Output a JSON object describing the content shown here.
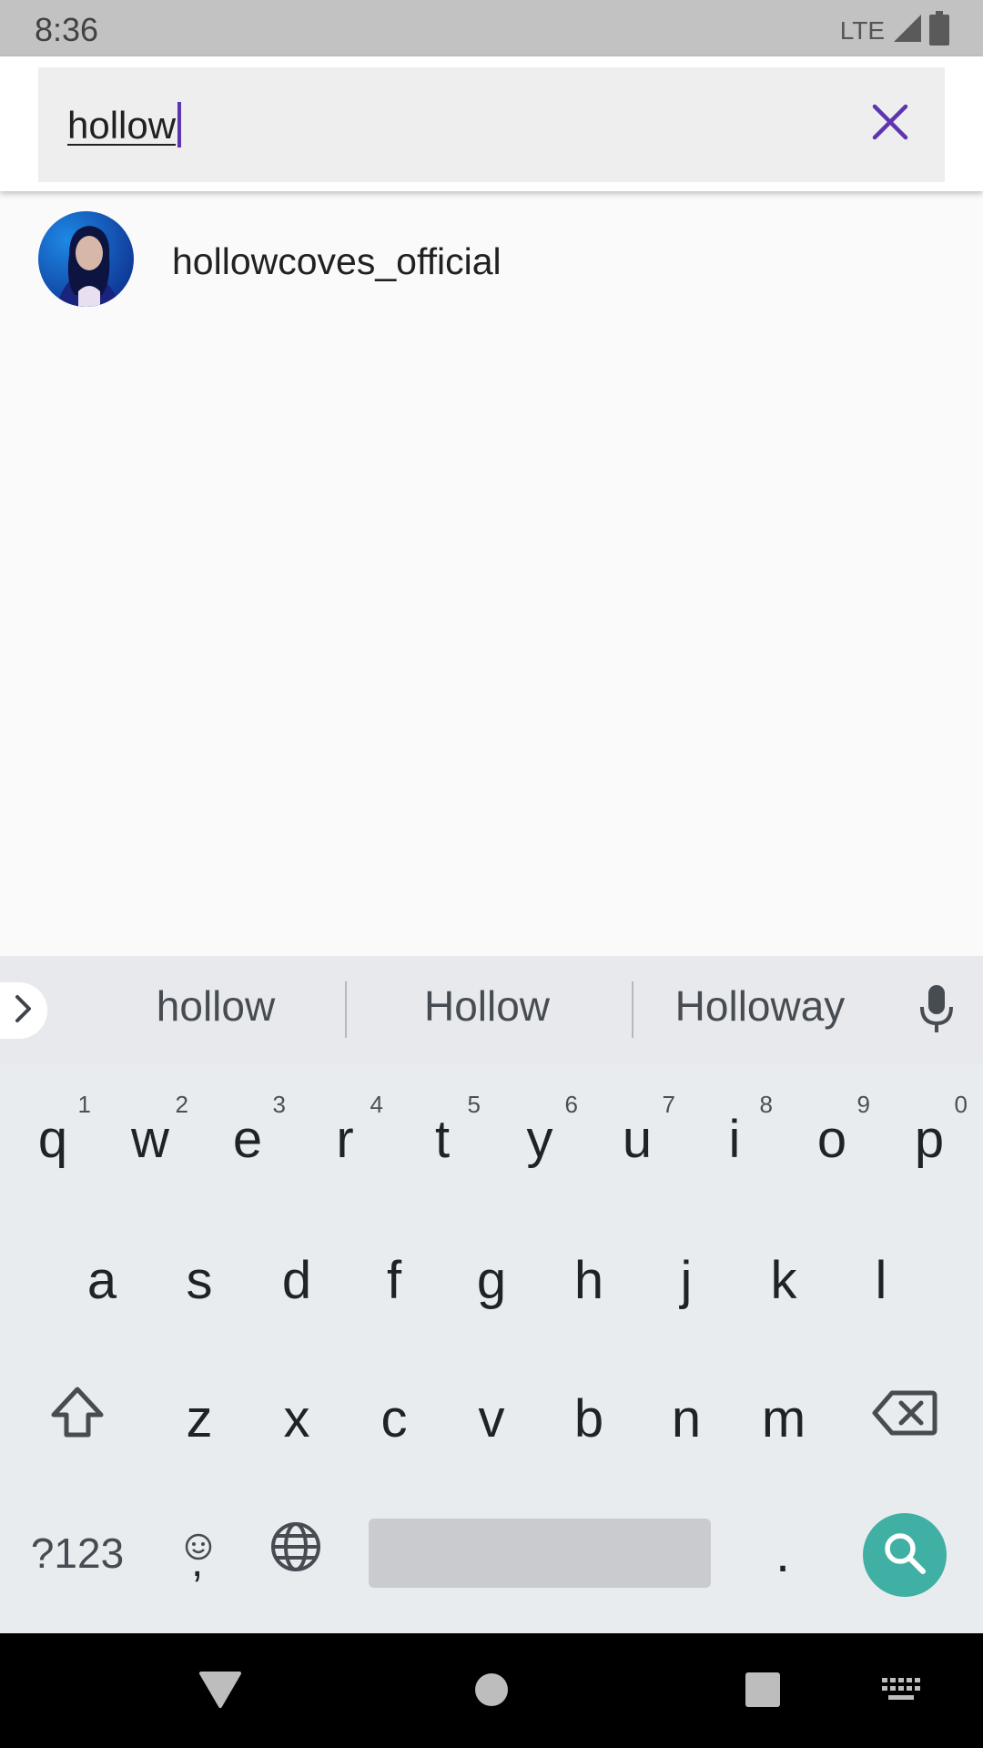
{
  "status_bar": {
    "time": "8:36",
    "network": "LTE"
  },
  "search": {
    "query": "hollow"
  },
  "results": [
    {
      "label": "hollowcoves_official"
    }
  ],
  "suggestions": [
    "hollow",
    "Hollow",
    "Holloway"
  ],
  "keyboard": {
    "row1": [
      {
        "key": "q",
        "hint": "1"
      },
      {
        "key": "w",
        "hint": "2"
      },
      {
        "key": "e",
        "hint": "3"
      },
      {
        "key": "r",
        "hint": "4"
      },
      {
        "key": "t",
        "hint": "5"
      },
      {
        "key": "y",
        "hint": "6"
      },
      {
        "key": "u",
        "hint": "7"
      },
      {
        "key": "i",
        "hint": "8"
      },
      {
        "key": "o",
        "hint": "9"
      },
      {
        "key": "p",
        "hint": "0"
      }
    ],
    "row2": [
      "a",
      "s",
      "d",
      "f",
      "g",
      "h",
      "j",
      "k",
      "l"
    ],
    "row3": [
      "z",
      "x",
      "c",
      "v",
      "b",
      "n",
      "m"
    ],
    "symbols_key": "?123",
    "comma_key": ",",
    "period_key": "."
  },
  "colors": {
    "accent": "#5e35b1",
    "search_key": "#3fb0a3",
    "status_bar": "#c2c2c2",
    "keyboard_bg": "#e9ecef"
  },
  "icons": {
    "clear": "close-icon",
    "expand": "chevron-right-icon",
    "mic": "microphone-icon",
    "shift": "shift-icon",
    "backspace": "backspace-icon",
    "emoji": "emoji-icon",
    "globe": "globe-icon",
    "search": "search-icon",
    "back": "nav-back-icon",
    "home": "nav-home-icon",
    "recents": "nav-recents-icon",
    "keyboard": "keyboard-icon"
  }
}
